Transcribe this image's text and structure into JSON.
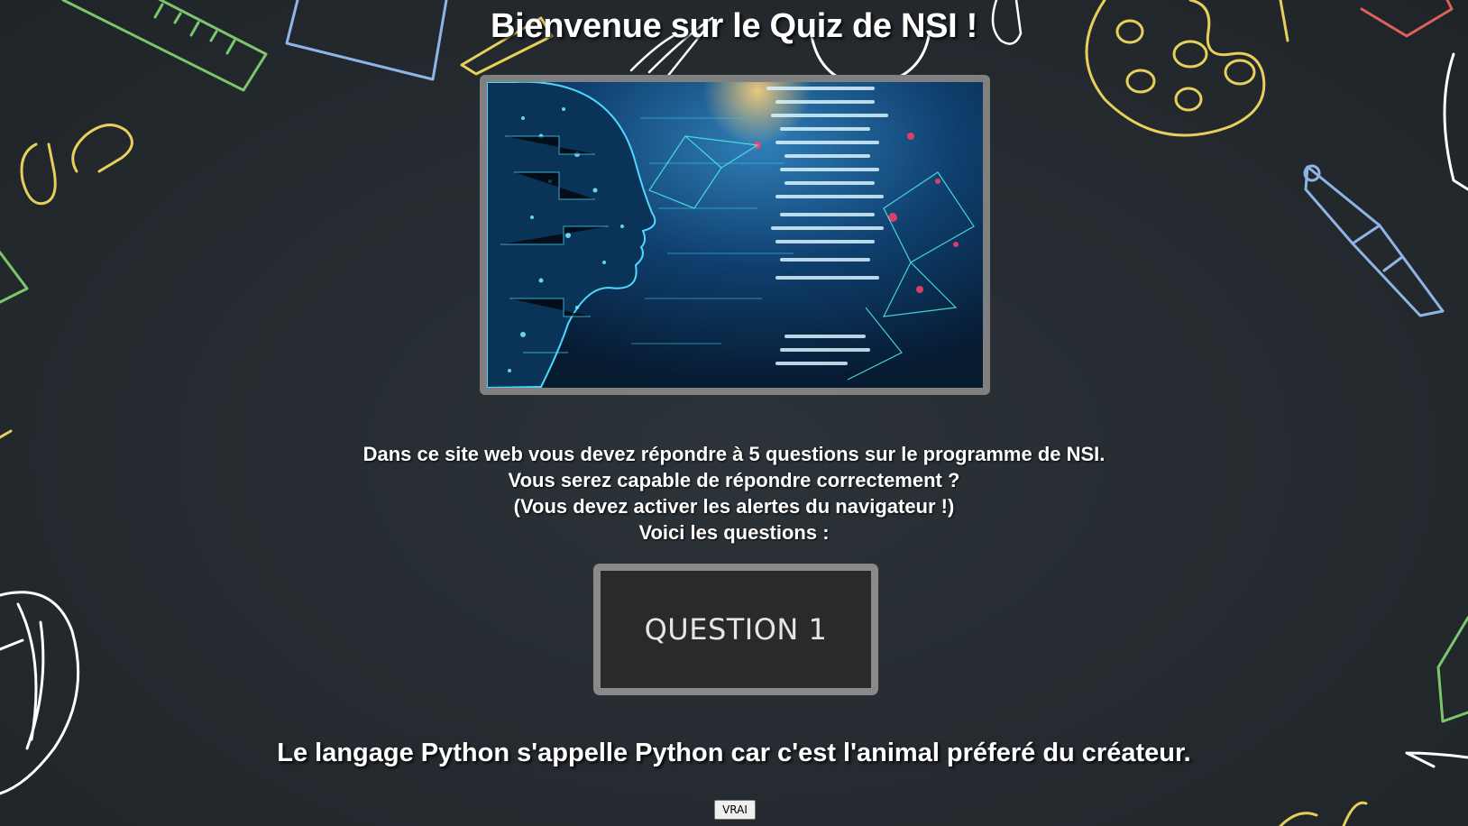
{
  "page": {
    "title": "Bienvenue sur le Quiz de NSI !",
    "hero_image": "ai-head-code-illustration",
    "background": "chalkboard-school-doodles",
    "accent_colors": {
      "board": "#262c31",
      "frame": "#808080",
      "button_bg": "#2a2a2a",
      "button_text": "#e6e6e6"
    }
  },
  "intro": {
    "lines": [
      "Dans ce site web vous devez répondre à 5 questions sur le programme de NSI.",
      "Vous serez capable de répondre correctement ?",
      "(Vous devez activer les alertes du navigateur !)",
      "Voici les questions :"
    ]
  },
  "question": {
    "button_label": "QUESTION 1",
    "statement": "Le langage Python s'appelle Python car c'est l'animal préferé du créateur.",
    "answer_button_label": "VRAI"
  }
}
